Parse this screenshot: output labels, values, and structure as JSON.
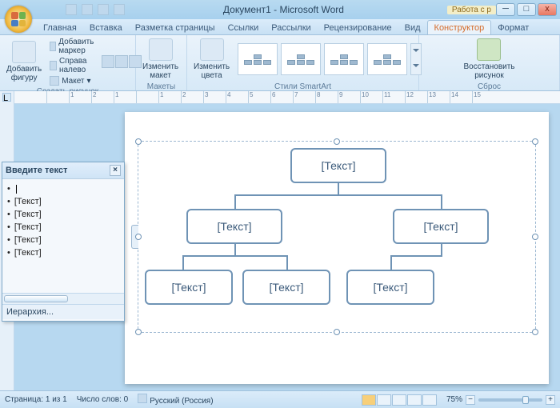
{
  "title": {
    "doc": "Документ1",
    "app": "Microsoft Word",
    "contextual": "Работа с р"
  },
  "tabs": [
    "Главная",
    "Вставка",
    "Разметка страницы",
    "Ссылки",
    "Рассылки",
    "Рецензирование",
    "Вид",
    "Конструктор",
    "Формат"
  ],
  "active_tab_index": 7,
  "ribbon": {
    "group1": {
      "label": "Создать рисунок",
      "add_shape": "Добавить\nфигуру",
      "items": [
        "Добавить маркер",
        "Справа налево",
        "Макет"
      ]
    },
    "group2": {
      "label": "Макеты",
      "change_layout": "Изменить\nмакет"
    },
    "group3": {
      "label": "Стили SmartArt",
      "change_colors": "Изменить\nцвета"
    },
    "group4": {
      "label": "Сброс",
      "reset": "Восстановить\nрисунок"
    }
  },
  "text_pane": {
    "title": "Введите текст",
    "items": [
      {
        "level": 1,
        "text": ""
      },
      {
        "level": 2,
        "text": "[Текст]"
      },
      {
        "level": 3,
        "text": "[Текст]"
      },
      {
        "level": 3,
        "text": "[Текст]"
      },
      {
        "level": 2,
        "text": "[Текст]"
      },
      {
        "level": 3,
        "text": "[Текст]"
      }
    ],
    "footer": "Иерархия..."
  },
  "smartart": {
    "placeholder": "[Текст]",
    "nodes": 6
  },
  "statusbar": {
    "page": "Страница: 1 из 1",
    "words": "Число слов: 0",
    "language": "Русский (Россия)",
    "zoom": "75%"
  },
  "ruler_numbers": [
    "",
    "1",
    "2",
    "1",
    "",
    "1",
    "2",
    "3",
    "4",
    "5",
    "6",
    "7",
    "8",
    "9",
    "10",
    "11",
    "12",
    "13",
    "14",
    "15"
  ]
}
